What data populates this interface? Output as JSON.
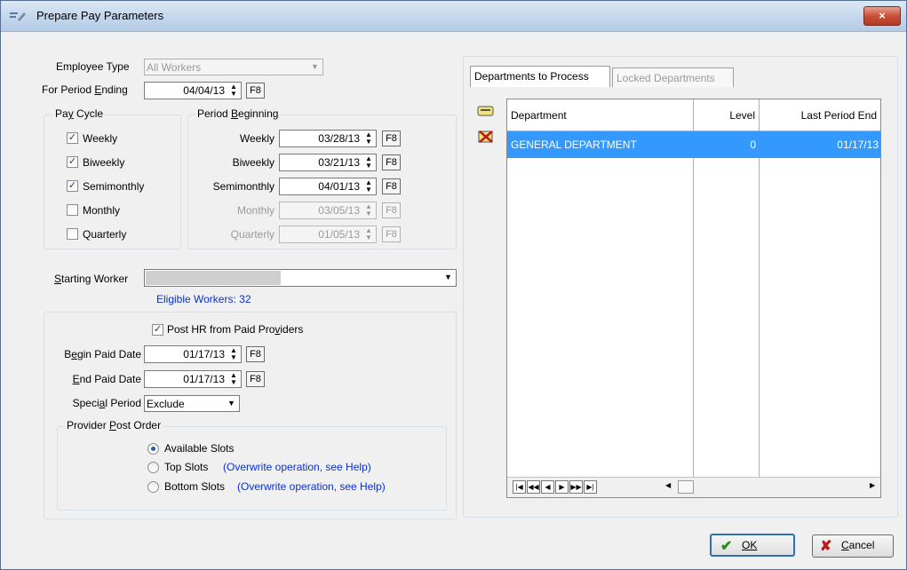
{
  "window": {
    "title": "Prepare Pay Parameters",
    "close_glyph": "×"
  },
  "employee_type": {
    "label": "Employee Type",
    "value": "All Workers"
  },
  "period_ending": {
    "label": "For Period Ending",
    "value": "04/04/13"
  },
  "f8": "F8",
  "pay_cycle": {
    "title": "Pay Cycle",
    "items": [
      {
        "label": "Weekly",
        "checked": "✓"
      },
      {
        "label": "Biweekly",
        "checked": "✓"
      },
      {
        "label": "Semimonthly",
        "checked": "✓"
      },
      {
        "label": "Monthly",
        "checked": ""
      },
      {
        "label": "Quarterly",
        "checked": ""
      }
    ]
  },
  "period_beginning": {
    "title": "Period Beginning",
    "rows": [
      {
        "label": "Weekly",
        "value": "03/28/13"
      },
      {
        "label": "Biweekly",
        "value": "03/21/13"
      },
      {
        "label": "Semimonthly",
        "value": "04/01/13"
      },
      {
        "label": "Monthly",
        "value": "03/05/13"
      },
      {
        "label": "Quarterly",
        "value": "01/05/13"
      }
    ]
  },
  "starting_worker": {
    "label": "Starting Worker",
    "value": ""
  },
  "eligible_workers": "Eligible Workers: 32",
  "post_hr": {
    "label": "Post HR from Paid Providers",
    "checked": "✓"
  },
  "begin_paid_date": {
    "label": "Begin Paid Date",
    "value": "01/17/13"
  },
  "end_paid_date": {
    "label": "End Paid Date",
    "value": "01/17/13"
  },
  "special_period": {
    "label": "Special Period",
    "value": "Exclude"
  },
  "provider_post_order": {
    "title": "Provider Post Order",
    "options": [
      {
        "label": "Available Slots",
        "note": ""
      },
      {
        "label": "Top Slots",
        "note": "(Overwrite operation, see Help)"
      },
      {
        "label": "Bottom Slots",
        "note": "(Overwrite operation, see Help)"
      }
    ]
  },
  "tabs": [
    {
      "label": "Departments to Process",
      "active": true
    },
    {
      "label": "Locked Departments",
      "active": false
    }
  ],
  "grid": {
    "columns": [
      "Department",
      "Level",
      "Last Period End"
    ],
    "rows": [
      {
        "department": "GENERAL DEPARTMENT",
        "level": "0",
        "last_period_end": "01/17/13"
      }
    ]
  },
  "nav": {
    "first": "|◀",
    "prev_page": "◀◀",
    "prev": "◀",
    "next": "▶",
    "next_page": "▶▶",
    "last": "▶|",
    "scroll_left": "◀",
    "scroll_right": "▶"
  },
  "buttons": {
    "ok": "OK",
    "cancel": "Cancel",
    "ok_icon": "✔",
    "cancel_icon": "✘"
  },
  "colors": {
    "selection": "#3399ff",
    "link_blue": "#0a2fd6",
    "title_bar": "#c3d6ec",
    "close_red": "#c8503a"
  }
}
